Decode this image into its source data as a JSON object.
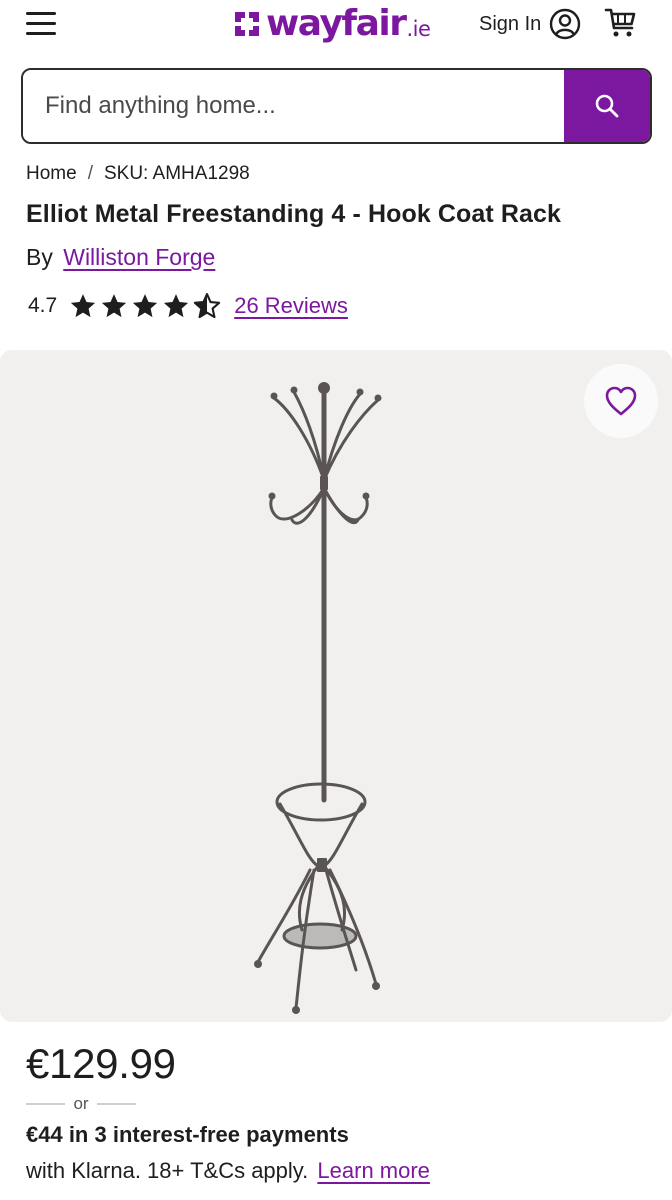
{
  "header": {
    "menu_icon": "hamburger-menu-icon",
    "logo_text": "wayfair",
    "logo_tld": ".ie",
    "sign_in_label": "Sign In",
    "account_icon": "account-circle-icon",
    "cart_icon": "shopping-cart-icon"
  },
  "search": {
    "placeholder": "Find anything home...",
    "value": "",
    "button_icon": "search-icon"
  },
  "breadcrumb": [
    {
      "label": "Home"
    },
    {
      "label": "SKU: AMHA1298"
    }
  ],
  "breadcrumb_separator": "/",
  "product": {
    "title": "Elliot Metal Freestanding 4 - Hook Coat Rack",
    "by_label": "By",
    "brand": "Williston Forge",
    "rating": "4.7",
    "rating_out_of": 5,
    "reviews_label": "26 Reviews",
    "favorite_icon": "heart-outline-icon",
    "image_subject": "coat-rack-image"
  },
  "pricing": {
    "price": "€129.99",
    "or_label": "or",
    "installment_text": "€44 in 3 interest-free payments",
    "klarna_text": "with Klarna. 18+ T&Cs apply.",
    "learn_more_label": "Learn more"
  },
  "colors": {
    "brand_purple": "#7b189f",
    "text": "#1e1e1e",
    "image_bg": "#f1f0ef"
  }
}
